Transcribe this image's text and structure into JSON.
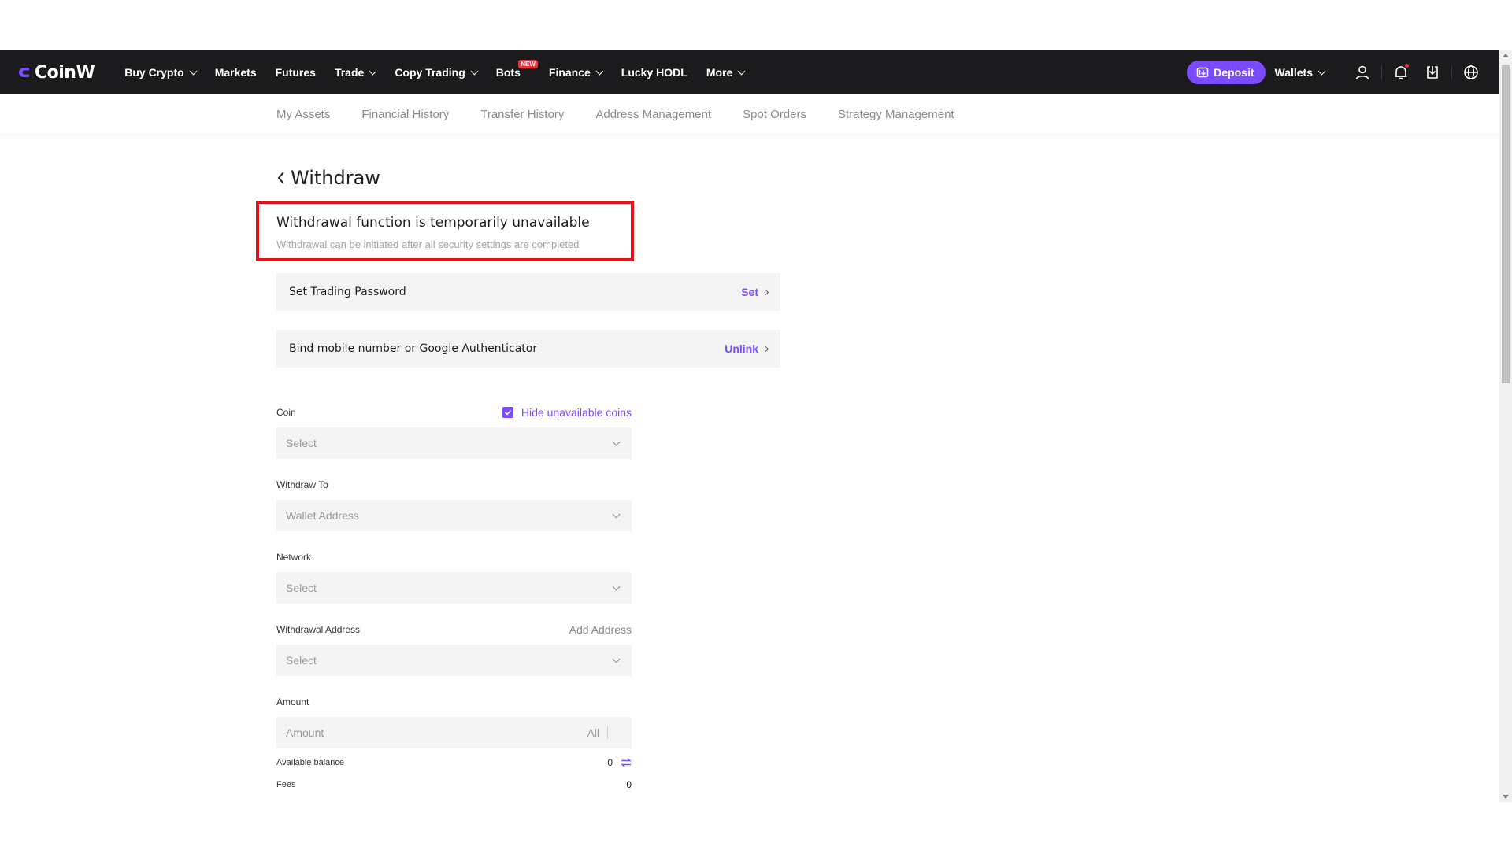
{
  "brand": {
    "name": "CoinW",
    "accent": "#7b4cff",
    "warn_color": "#e5131d"
  },
  "nav": {
    "items": [
      {
        "label": "Buy Crypto",
        "dropdown": true
      },
      {
        "label": "Markets",
        "dropdown": false
      },
      {
        "label": "Futures",
        "dropdown": false
      },
      {
        "label": "Trade",
        "dropdown": true
      },
      {
        "label": "Copy Trading",
        "dropdown": true
      },
      {
        "label": "Bots",
        "dropdown": false,
        "badge": "NEW"
      },
      {
        "label": "Finance",
        "dropdown": true
      },
      {
        "label": "Lucky HODL",
        "dropdown": false
      },
      {
        "label": "More",
        "dropdown": true
      }
    ],
    "deposit_label": "Deposit",
    "wallets_label": "Wallets",
    "icons": [
      "user-icon",
      "bell-icon",
      "download-icon",
      "globe-icon"
    ]
  },
  "subnav": {
    "items": [
      "My Assets",
      "Financial History",
      "Transfer History",
      "Address Management",
      "Spot Orders",
      "Strategy Management"
    ]
  },
  "page": {
    "title": "Withdraw",
    "warning": {
      "title": "Withdrawal function is temporarily unavailable",
      "subtitle": "Withdrawal can be initiated after all security settings are completed"
    },
    "security": [
      {
        "label": "Set Trading Password",
        "action": "Set"
      },
      {
        "label": "Bind mobile number or Google Authenticator",
        "action": "Unlink"
      }
    ]
  },
  "form": {
    "coin": {
      "label": "Coin",
      "placeholder": "Select",
      "hide_unavailable_label": "Hide unavailable coins",
      "hide_unavailable_checked": true
    },
    "withdraw_to": {
      "label": "Withdraw To",
      "value": "Wallet Address"
    },
    "network": {
      "label": "Network",
      "placeholder": "Select"
    },
    "address": {
      "label": "Withdrawal Address",
      "placeholder": "Select",
      "add_label": "Add Address"
    },
    "amount": {
      "label": "Amount",
      "placeholder": "Amount",
      "all_label": "All"
    },
    "available_balance": {
      "label": "Available balance",
      "value": "0"
    },
    "fees": {
      "label": "Fees",
      "value": "0"
    }
  }
}
